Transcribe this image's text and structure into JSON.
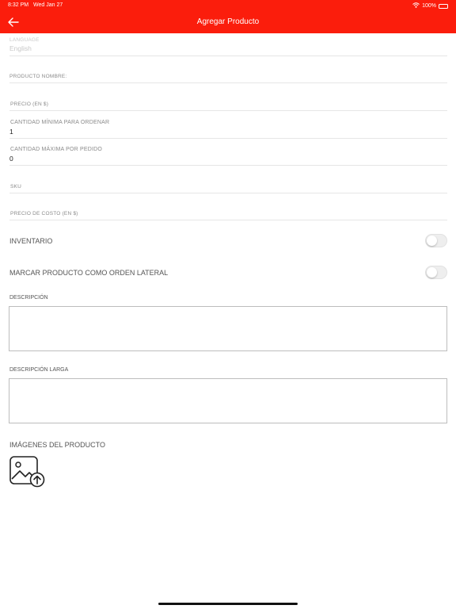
{
  "status": {
    "time": "8:32 PM",
    "date": "Wed Jan 27",
    "battery": "100%"
  },
  "header": {
    "title": "Agregar Producto"
  },
  "form": {
    "language": {
      "label": "LANGUAGE",
      "value": "English"
    },
    "name": {
      "label": "PRODUCTO NOMBRE:",
      "value": ""
    },
    "price": {
      "label": "PRECIO (EN $)",
      "value": ""
    },
    "min_qty": {
      "label": "CANTIDAD MÍNIMA PARA ORDENAR",
      "value": "1"
    },
    "max_qty": {
      "label": "CANTIDAD MÁXIMA POR PEDIDO",
      "value": "0"
    },
    "sku": {
      "label": "SKU",
      "value": ""
    },
    "cost": {
      "label": "PRECIO DE COSTO (EN $)",
      "value": ""
    },
    "inventory": {
      "label": "INVENTARIO",
      "on": false
    },
    "side_order": {
      "label": "MARCAR PRODUCTO COMO ORDEN LATERAL",
      "on": false
    },
    "description": {
      "label": "DESCRIPCIÓN",
      "value": ""
    },
    "long_description": {
      "label": "DESCRIPCIÓN LARGA",
      "value": ""
    },
    "images": {
      "label": "IMÁGENES DEL PRODUCTO"
    }
  },
  "icons": {
    "back": "arrow-left-icon",
    "upload": "image-upload-icon",
    "wifi": "wifi-icon",
    "battery": "battery-icon"
  },
  "colors": {
    "accent": "#fb1d0c",
    "divider": "#e6e6e6",
    "border": "#bdbdbd"
  }
}
